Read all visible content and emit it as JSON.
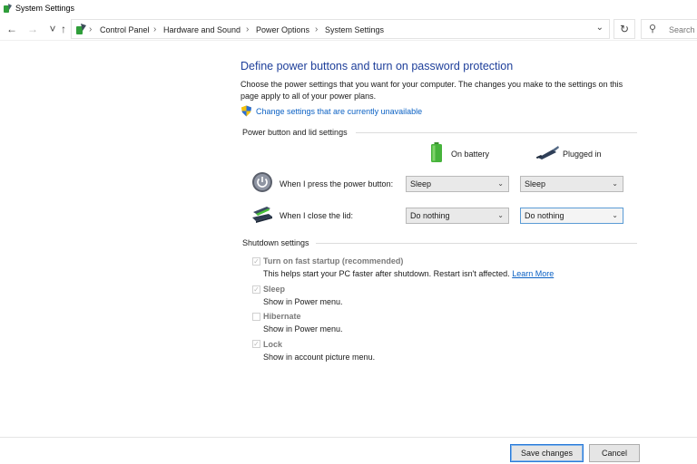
{
  "window": {
    "title": "System Settings"
  },
  "nav": {
    "back_icon": "back-arrow-icon",
    "forward_icon": "forward-arrow-icon",
    "up_icon": "up-arrow-icon",
    "breadcrumbs": [
      "Control Panel",
      "Hardware and Sound",
      "Power Options",
      "System Settings"
    ],
    "separator": "›",
    "dropdown_icon": "chevron-down-icon",
    "refresh_icon": "refresh-icon",
    "search_placeholder": "Search C"
  },
  "page": {
    "heading": "Define power buttons and turn on password protection",
    "description": "Choose the power settings that you want for your computer. The changes you make to the settings on this page apply to all of your power plans.",
    "admin_link": "Change settings that are currently unavailable"
  },
  "power_section": {
    "label": "Power button and lid settings",
    "columns": {
      "battery": "On battery",
      "plugged": "Plugged in"
    },
    "rows": [
      {
        "label": "When I press the power button:",
        "battery": "Sleep",
        "plugged": "Sleep"
      },
      {
        "label": "When I close the lid:",
        "battery": "Do nothing",
        "plugged": "Do nothing"
      }
    ]
  },
  "shutdown_section": {
    "label": "Shutdown settings",
    "items": [
      {
        "title": "Turn on fast startup (recommended)",
        "desc": "This helps start your PC faster after shutdown. Restart isn't affected.",
        "link": "Learn More",
        "checked": true
      },
      {
        "title": "Sleep",
        "desc": "Show in Power menu.",
        "checked": true
      },
      {
        "title": "Hibernate",
        "desc": "Show in Power menu.",
        "checked": false
      },
      {
        "title": "Lock",
        "desc": "Show in account picture menu.",
        "checked": true
      }
    ]
  },
  "buttons": {
    "save": "Save changes",
    "cancel": "Cancel"
  },
  "colors": {
    "heading": "#1e3f9a",
    "link": "#0b61c4",
    "accent": "#2a7ad8"
  }
}
